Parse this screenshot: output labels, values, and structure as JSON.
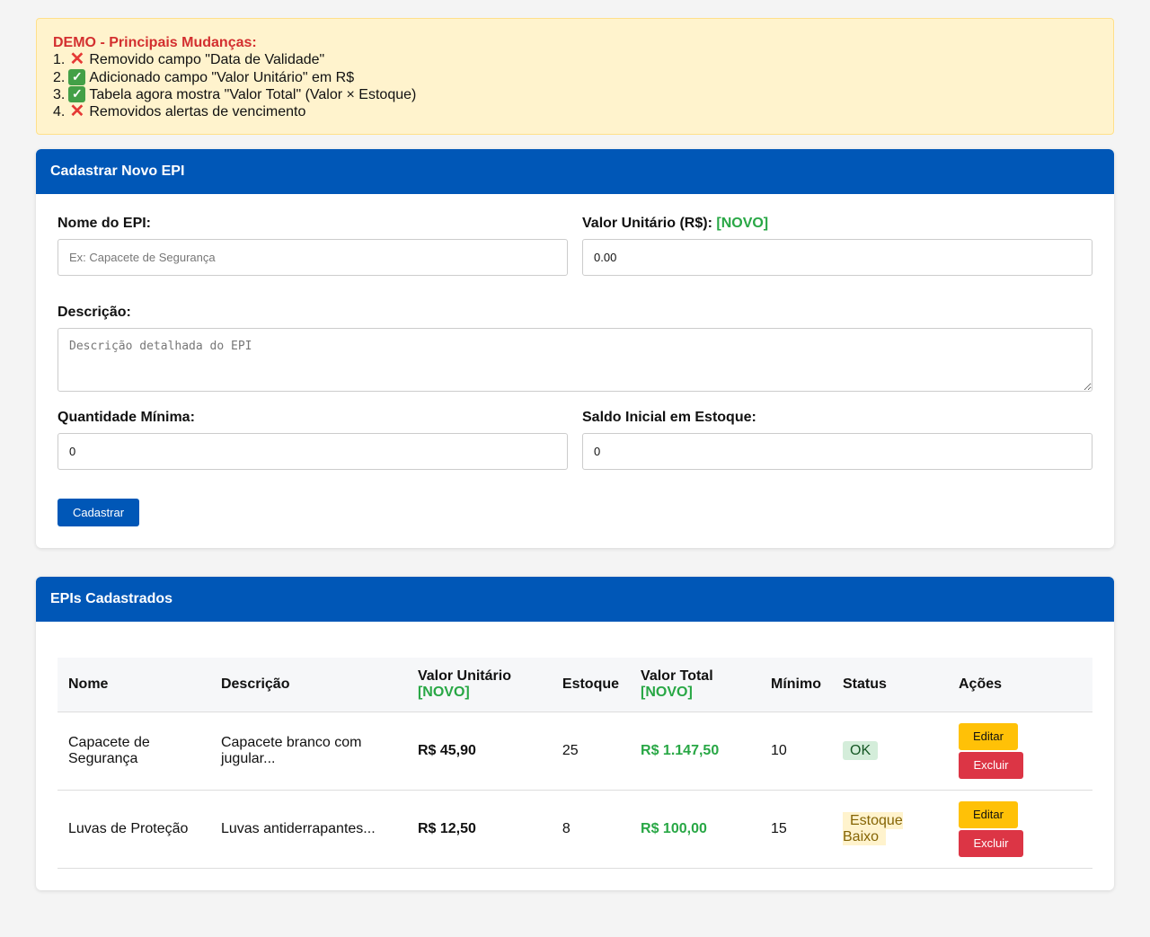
{
  "banner": {
    "title": "DEMO - Principais Mudanças:",
    "items": [
      {
        "num": "1.",
        "icon": "cross-mark-icon",
        "text": "Removido campo \"Data de Validade\""
      },
      {
        "num": "2.",
        "icon": "check-mark-icon",
        "text": "Adicionado campo \"Valor Unitário\" em R$"
      },
      {
        "num": "3.",
        "icon": "check-mark-icon",
        "text": "Tabela agora mostra \"Valor Total\" (Valor × Estoque)"
      },
      {
        "num": "4.",
        "icon": "cross-mark-icon",
        "text": "Removidos alertas de vencimento"
      }
    ]
  },
  "form": {
    "header": "Cadastrar Novo EPI",
    "nome_label": "Nome do EPI:",
    "nome_placeholder": "Ex: Capacete de Segurança",
    "valor_label": "Valor Unitário (R$):",
    "valor_novo": "[NOVO]",
    "valor_value": "0.00",
    "descricao_label": "Descrição:",
    "descricao_placeholder": "Descrição detalhada do EPI",
    "qtd_min_label": "Quantidade Mínima:",
    "qtd_min_value": "0",
    "saldo_label": "Saldo Inicial em Estoque:",
    "saldo_value": "0",
    "submit_label": "Cadastrar"
  },
  "table": {
    "header": "EPIs Cadastrados",
    "columns": {
      "nome": "Nome",
      "descricao": "Descrição",
      "valor_unitario": "Valor Unitário",
      "valor_unitario_novo": "[NOVO]",
      "estoque": "Estoque",
      "valor_total": "Valor Total",
      "valor_total_novo": "[NOVO]",
      "minimo": "Mínimo",
      "status": "Status",
      "acoes": "Ações"
    },
    "rows": [
      {
        "nome": "Capacete de Segurança",
        "descricao": "Capacete branco com jugular...",
        "valor": "R$ 45,90",
        "estoque": "25",
        "total": "R$ 1.147,50",
        "minimo": "10",
        "status": "OK",
        "edit": "Editar",
        "delete": "Excluir"
      },
      {
        "nome": "Luvas de Proteção",
        "descricao": "Luvas antiderrapantes...",
        "valor": "R$ 12,50",
        "estoque": "8",
        "total": "R$ 100,00",
        "minimo": "15",
        "status": "Estoque Baixo",
        "edit": "Editar",
        "delete": "Excluir"
      }
    ]
  },
  "colors": {
    "primary": "#0057b7",
    "novo_green": "#28a745",
    "banner_bg": "#fff3cd",
    "banner_title": "#d32f2f",
    "edit_yellow": "#ffc107",
    "delete_red": "#dc3545"
  }
}
